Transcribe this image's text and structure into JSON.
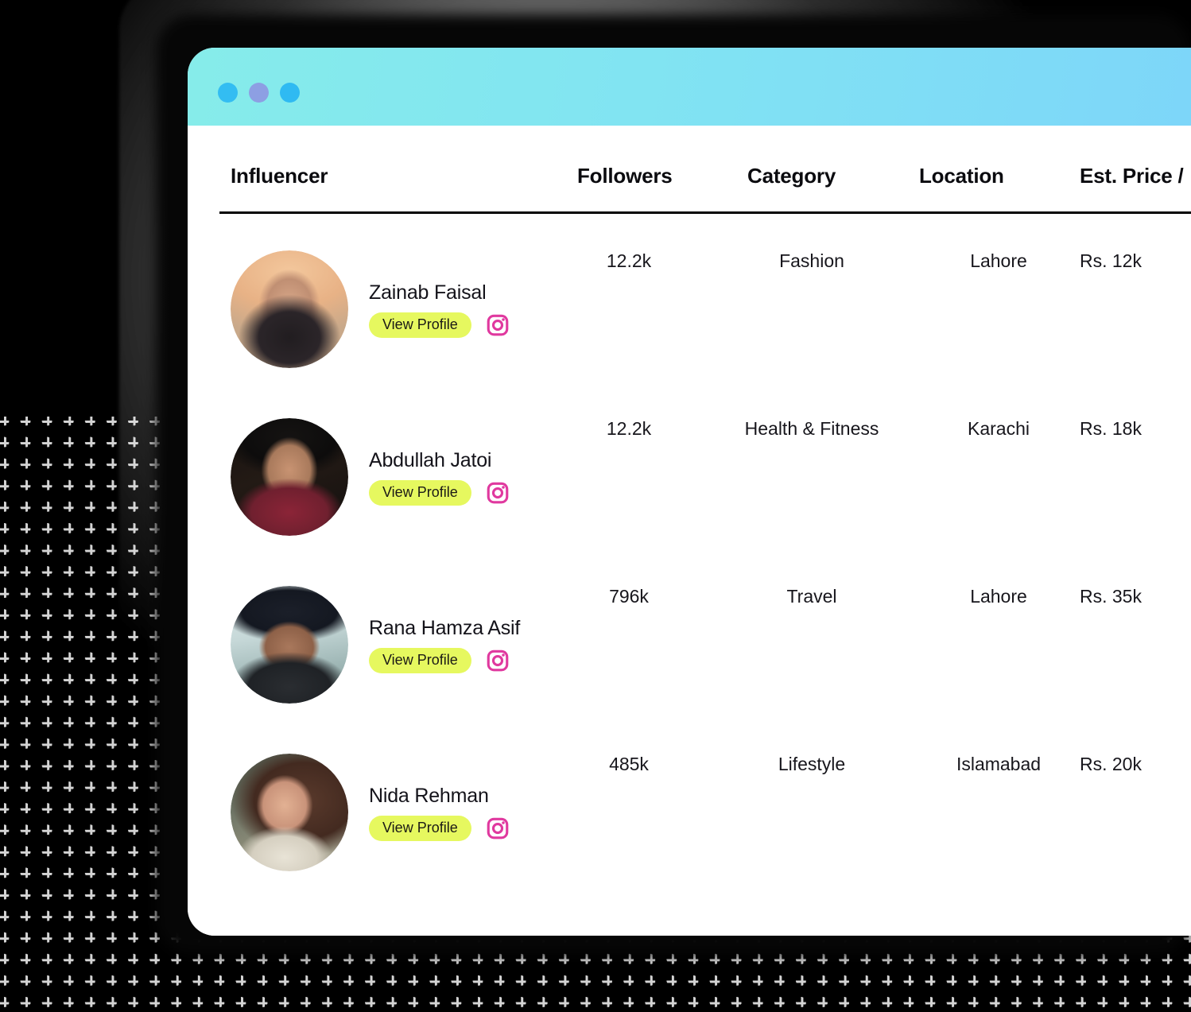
{
  "window": {
    "titlebar": {
      "dots": [
        {
          "name": "window-dot-1",
          "color": "#33bdf2"
        },
        {
          "name": "window-dot-2",
          "color": "#8d9fe3"
        },
        {
          "name": "window-dot-3",
          "color": "#2fbaf2"
        }
      ],
      "gradient_from": "#86ecea",
      "gradient_to": "#7dd6f9"
    }
  },
  "table": {
    "headers": {
      "influencer": "Influencer",
      "followers": "Followers",
      "category": "Category",
      "location": "Location",
      "price": "Est. Price /"
    },
    "row_action_label": "View Profile",
    "social_icon": "instagram-icon",
    "accent_badge_color": "#e6f85f",
    "instagram_icon_color": "#e0399f",
    "rows": [
      {
        "name": "Zainab Faisal",
        "followers": "12.2k",
        "category": "Fashion",
        "location": "Lahore",
        "price": "Rs. 12k",
        "action": "View Profile",
        "avatar": "avatar-zainab-faisal"
      },
      {
        "name": "Abdullah Jatoi",
        "followers": "12.2k",
        "category": "Health & Fitness",
        "location": "Karachi",
        "price": "Rs. 18k",
        "action": "View Profile",
        "avatar": "avatar-abdullah-jatoi"
      },
      {
        "name": "Rana Hamza Asif",
        "followers": "796k",
        "category": "Travel",
        "location": "Lahore",
        "price": "Rs. 35k",
        "action": "View Profile",
        "avatar": "avatar-rana-hamza-asif"
      },
      {
        "name": "Nida Rehman",
        "followers": "485k",
        "category": "Lifestyle",
        "location": "Islamabad",
        "price": "Rs. 20k",
        "action": "View Profile",
        "avatar": "avatar-nida-rehman"
      }
    ]
  },
  "background": {
    "base_color": "#000000",
    "plus_mark_color": "#d4d4d4"
  }
}
